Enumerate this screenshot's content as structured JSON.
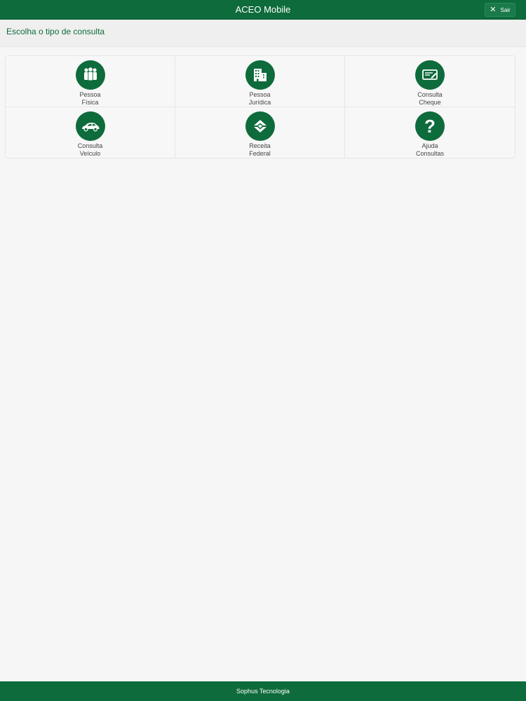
{
  "header": {
    "title": "ACEO Mobile",
    "exit_button": {
      "icon": "close-icon",
      "label": "Sair"
    }
  },
  "subheader": {
    "label": "Escolha o tipo de consulta"
  },
  "menu": {
    "items": [
      {
        "line1": "Pessoa",
        "line2": "Física",
        "icon": "people-icon"
      },
      {
        "line1": "Pessoa",
        "line2": "Jurídica",
        "icon": "building-icon"
      },
      {
        "line1": "Consulta",
        "line2": "Cheque",
        "icon": "check-icon"
      },
      {
        "line1": "Consulta",
        "line2": "Veículo",
        "icon": "car-icon"
      },
      {
        "line1": "Receita",
        "line2": "Federal",
        "icon": "receita-federal-icon"
      },
      {
        "line1": "Ajuda",
        "line2": "Consultas",
        "icon": "help-icon"
      }
    ]
  },
  "footer": {
    "text": "Sophus Tecnologia"
  },
  "colors": {
    "brand": "#0e6b3b",
    "background": "#f6f6f6",
    "text": "#444444"
  }
}
